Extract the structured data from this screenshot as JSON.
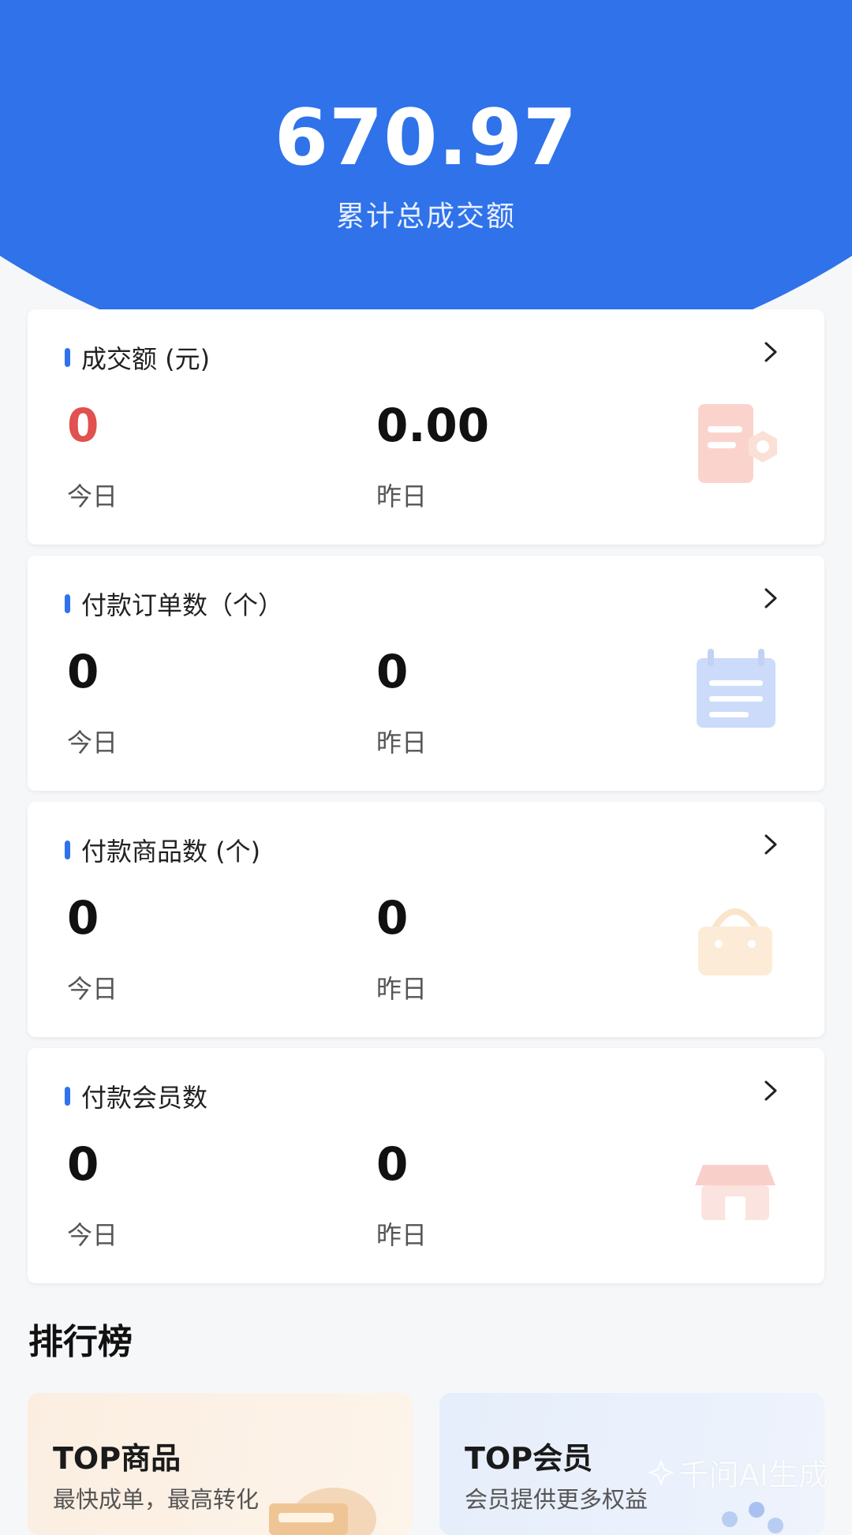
{
  "header": {
    "total_amount": "670.97",
    "total_caption": "累计总成交额"
  },
  "stats": [
    {
      "title": "成交额 (元)",
      "today_value": "0",
      "today_label": "今日",
      "yesterday_value": "0.00",
      "yesterday_label": "昨日",
      "icon": "receipt-icon"
    },
    {
      "title": "付款订单数（个）",
      "today_value": "0",
      "today_label": "今日",
      "yesterday_value": "0",
      "yesterday_label": "昨日",
      "icon": "calendar-icon"
    },
    {
      "title": "付款商品数 (个)",
      "today_value": "0",
      "today_label": "今日",
      "yesterday_value": "0",
      "yesterday_label": "昨日",
      "icon": "shopping-basket-icon"
    },
    {
      "title": "付款会员数",
      "today_value": "0",
      "today_label": "今日",
      "yesterday_value": "0",
      "yesterday_label": "昨日",
      "icon": "store-icon"
    }
  ],
  "ranking": {
    "title": "排行榜",
    "cards": [
      {
        "title": "TOP商品",
        "subtitle": "最快成单，最高转化"
      },
      {
        "title": "TOP会员",
        "subtitle": "会员提供更多权益"
      }
    ]
  },
  "watermark": "千问AI生成",
  "colors": {
    "primary": "#2f72ea",
    "today_highlight": "#e0514f"
  }
}
